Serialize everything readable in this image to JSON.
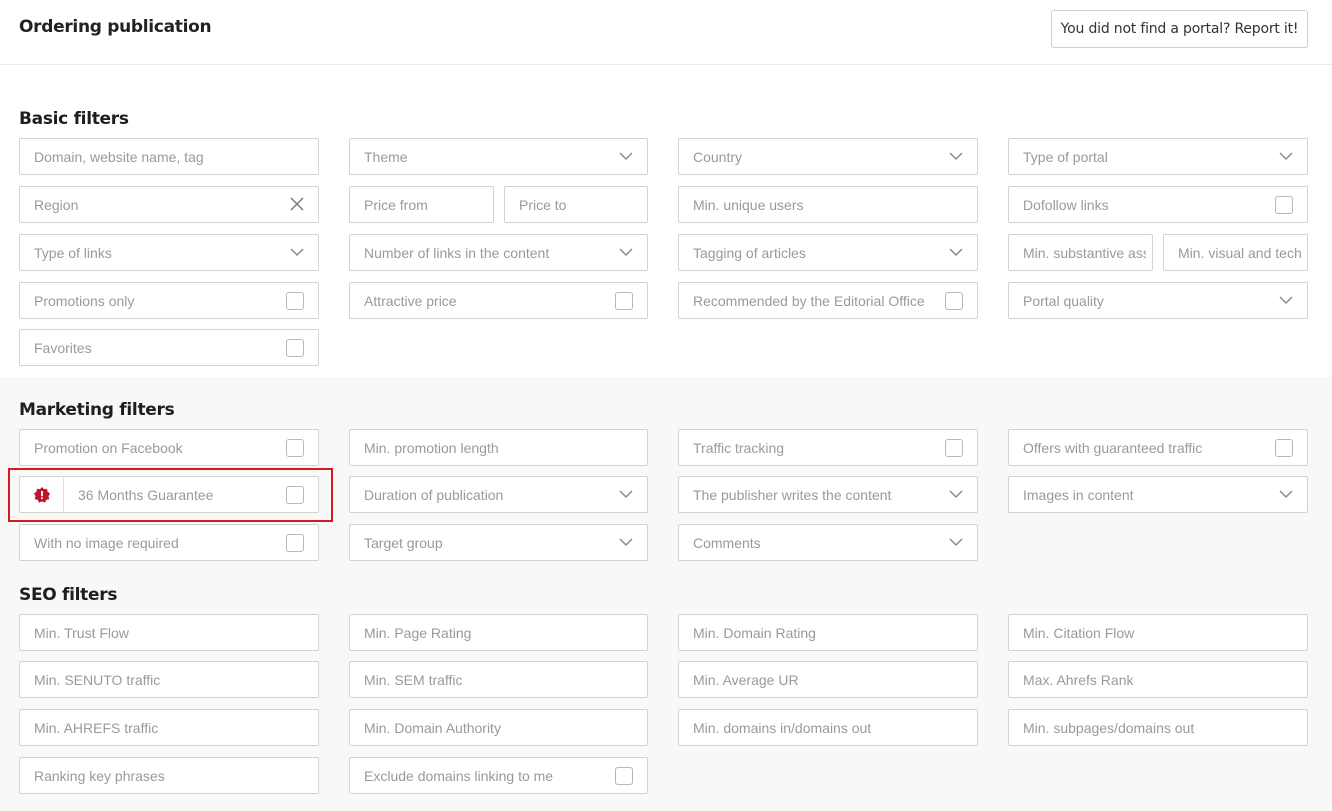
{
  "header": {
    "title": "Ordering publication",
    "report_label": "You did not find a portal? Report it!"
  },
  "basic": {
    "title": "Basic filters",
    "domain": "Domain, website name, tag",
    "theme": "Theme",
    "country": "Country",
    "type_of_portal": "Type of portal",
    "region": "Region",
    "price_from": "Price from",
    "price_to": "Price to",
    "min_unique_users": "Min. unique users",
    "dofollow_links": "Dofollow links",
    "type_of_links": "Type of links",
    "number_of_links": "Number of links in the content",
    "tagging_of_articles": "Tagging of articles",
    "min_substantive": "Min. substantive assessment",
    "min_visual": "Min. visual and technical assessment",
    "promotions_only": "Promotions only",
    "attractive_price": "Attractive price",
    "recommended": "Recommended by the Editorial Office",
    "portal_quality": "Portal quality",
    "favorites": "Favorites"
  },
  "marketing": {
    "title": "Marketing filters",
    "promotion_facebook": "Promotion on Facebook",
    "min_promotion_length": "Min. promotion length",
    "traffic_tracking": "Traffic tracking",
    "guaranteed_traffic": "Offers with guaranteed traffic",
    "months_guarantee": "36 Months Guarantee",
    "duration": "Duration of publication",
    "publisher_writes": "The publisher writes the content",
    "images_in_content": "Images in content",
    "no_image_required": "With no image required",
    "target_group": "Target group",
    "comments": "Comments"
  },
  "seo": {
    "title": "SEO filters",
    "trust_flow": "Min. Trust Flow",
    "page_rating": "Min. Page Rating",
    "domain_rating": "Min. Domain Rating",
    "citation_flow": "Min. Citation Flow",
    "senuto_traffic": "Min. SENUTO traffic",
    "sem_traffic": "Min. SEM traffic",
    "average_ur": "Min. Average UR",
    "ahrefs_rank": "Max. Ahrefs Rank",
    "ahrefs_traffic": "Min. AHREFS traffic",
    "domain_authority": "Min. Domain Authority",
    "domains_in_out": "Min. domains in/domains out",
    "subpages_out": "Min. subpages/domains out",
    "ranking_phrases": "Ranking key phrases",
    "exclude_domains": "Exclude domains linking to me"
  },
  "colors": {
    "highlight": "#d8191f",
    "badge": "#c0142a",
    "border": "#d3d3d3",
    "placeholder": "#9a9a9a"
  }
}
